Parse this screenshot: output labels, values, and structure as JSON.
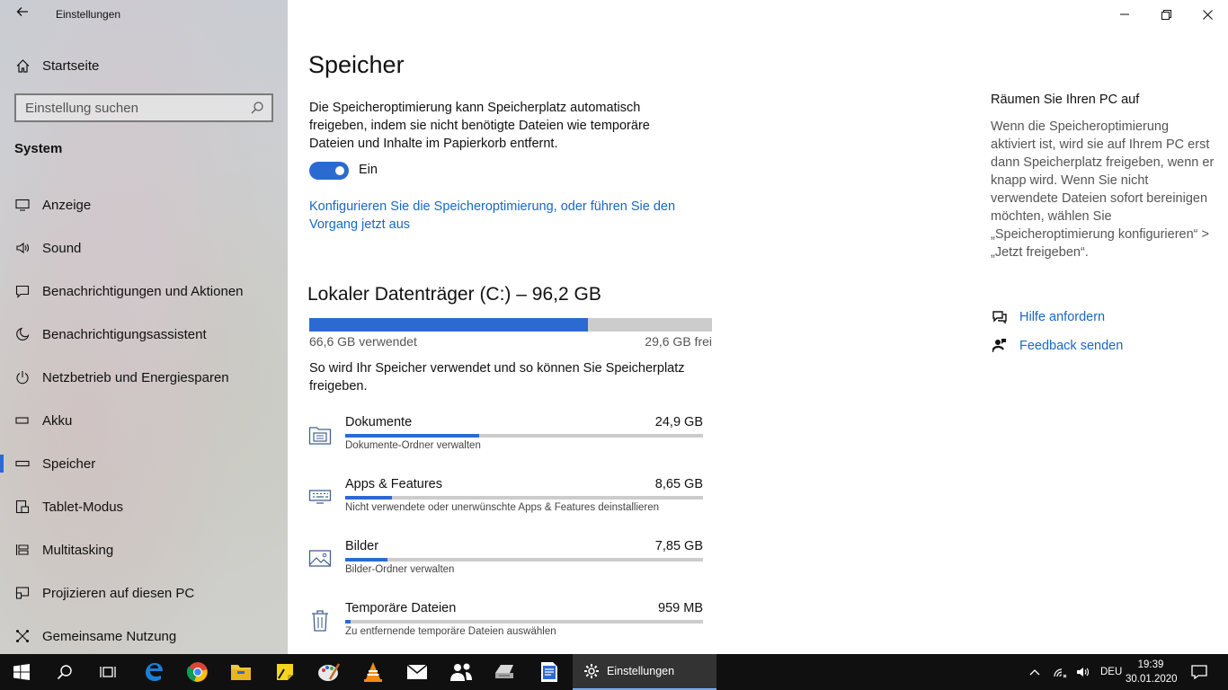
{
  "window": {
    "title": "Einstellungen",
    "back_icon": "back-arrow-icon",
    "controls": [
      "minimize-icon",
      "restore-icon",
      "close-icon"
    ]
  },
  "sidebar": {
    "home_label": "Startseite",
    "search_placeholder": "Einstellung suchen",
    "section_title": "System",
    "items": [
      {
        "label": "Anzeige",
        "icon": "display-icon"
      },
      {
        "label": "Sound",
        "icon": "speaker-icon"
      },
      {
        "label": "Benachrichtigungen und Aktionen",
        "icon": "notification-icon"
      },
      {
        "label": "Benachrichtigungsassistent",
        "icon": "moon-icon"
      },
      {
        "label": "Netzbetrieb und Energiesparen",
        "icon": "power-icon"
      },
      {
        "label": "Akku",
        "icon": "battery-icon"
      },
      {
        "label": "Speicher",
        "icon": "storage-icon",
        "active": true
      },
      {
        "label": "Tablet-Modus",
        "icon": "tablet-icon"
      },
      {
        "label": "Multitasking",
        "icon": "multitasking-icon"
      },
      {
        "label": "Projizieren auf diesen PC",
        "icon": "project-icon"
      },
      {
        "label": "Gemeinsame Nutzung",
        "icon": "share-icon"
      }
    ]
  },
  "main": {
    "title": "Speicher",
    "description": "Die Speicheroptimierung kann Speicherplatz automatisch freigeben, indem sie nicht benötigte Dateien wie temporäre Dateien und Inhalte im Papierkorb entfernt.",
    "toggle_state": "Ein",
    "config_link": "Konfigurieren Sie die Speicheroptimierung, oder führen Sie den Vorgang jetzt aus",
    "drive": {
      "title": "Lokaler Datenträger (C:) – 96,2 GB",
      "used_label": "66,6 GB verwendet",
      "free_label": "29,6 GB frei",
      "used_fraction": 0.692
    },
    "usage_description": "So wird Ihr Speicher verwendet und so können Sie Speicherplatz freigeben.",
    "categories": [
      {
        "name": "Dokumente",
        "size": "24,9 GB",
        "sub": "Dokumente-Ordner verwalten",
        "icon": "documents-folder-icon",
        "fraction": 0.374
      },
      {
        "name": "Apps & Features",
        "size": "8,65 GB",
        "sub": "Nicht verwendete oder unerwünschte Apps & Features deinstallieren",
        "icon": "keyboard-icon",
        "fraction": 0.13
      },
      {
        "name": "Bilder",
        "size": "7,85 GB",
        "sub": "Bilder-Ordner verwalten",
        "icon": "image-icon",
        "fraction": 0.118
      },
      {
        "name": "Temporäre Dateien",
        "size": "959 MB",
        "sub": "Zu entfernende temporäre Dateien auswählen",
        "icon": "trash-icon",
        "fraction": 0.014
      }
    ]
  },
  "side_panel": {
    "heading": "Räumen Sie Ihren PC auf",
    "text": "Wenn die Speicheroptimierung aktiviert ist, wird sie auf Ihrem PC erst dann Speicherplatz freigeben, wenn er knapp wird. Wenn Sie nicht verwendete Dateien sofort bereinigen möchten, wählen Sie „Speicheroptimierung konfigurieren“ > „Jetzt freigeben“.",
    "help_link": "Hilfe anfordern",
    "feedback_link": "Feedback senden"
  },
  "taskbar": {
    "active_app": "Einstellungen",
    "language": "DEU",
    "time": "19:39",
    "date": "30.01.2020",
    "pinned_icons": [
      "start-icon",
      "search-icon",
      "task-view-icon",
      "edge-icon",
      "chrome-icon",
      "file-explorer-icon",
      "sticky-notes-icon",
      "paint-icon",
      "vlc-icon",
      "mail-icon",
      "people-icon",
      "scanner-icon",
      "document-icon"
    ],
    "colors": {
      "accent": "#2b6bd1",
      "link": "#1a66c7",
      "taskbar": "#101010"
    }
  }
}
